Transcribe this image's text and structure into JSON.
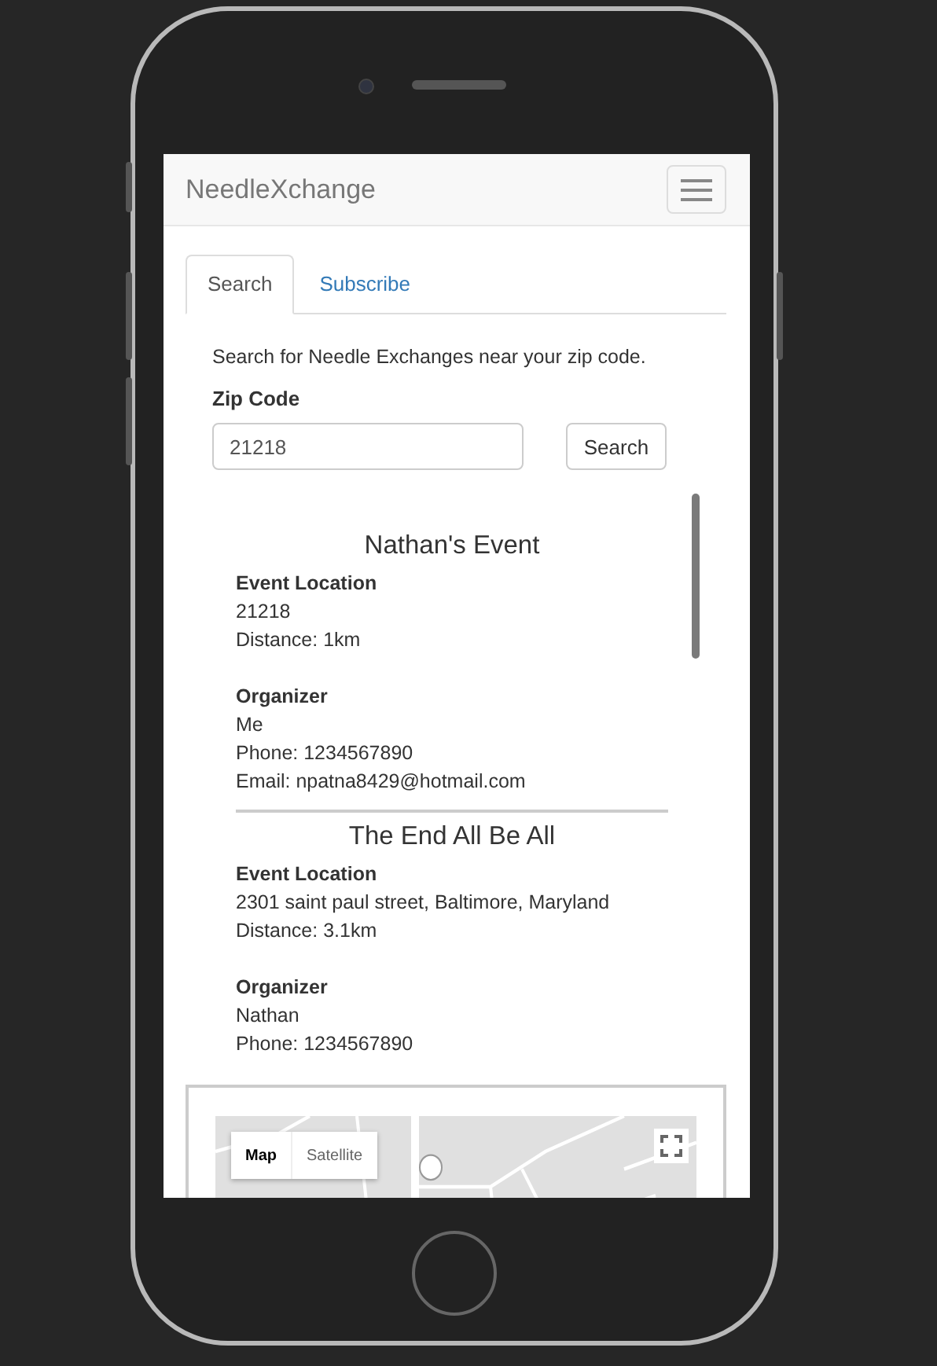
{
  "navbar": {
    "brand": "NeedleXchange"
  },
  "tabs": [
    {
      "label": "Search",
      "selected": true
    },
    {
      "label": "Subscribe",
      "selected": false
    }
  ],
  "search": {
    "intro": "Search for Needle Exchanges near your zip code.",
    "zip_label": "Zip Code",
    "zip_value": "21218",
    "button": "Search"
  },
  "events": [
    {
      "title": "Nathan's Event",
      "location_label": "Event Location",
      "location": "21218",
      "distance": "Distance: 1km",
      "organizer_label": "Organizer",
      "organizer": "Me",
      "phone": "Phone: 1234567890",
      "email": "Email: npatna8429@hotmail.com"
    },
    {
      "title": "The End All Be All",
      "location_label": "Event Location",
      "location": "2301 saint paul street, Baltimore, Maryland",
      "distance": "Distance: 3.1km",
      "organizer_label": "Organizer",
      "organizer": "Nathan",
      "phone": "Phone: 1234567890"
    }
  ],
  "map": {
    "map_types": [
      {
        "label": "Map",
        "selected": true
      },
      {
        "label": "Satellite",
        "selected": false
      }
    ]
  }
}
